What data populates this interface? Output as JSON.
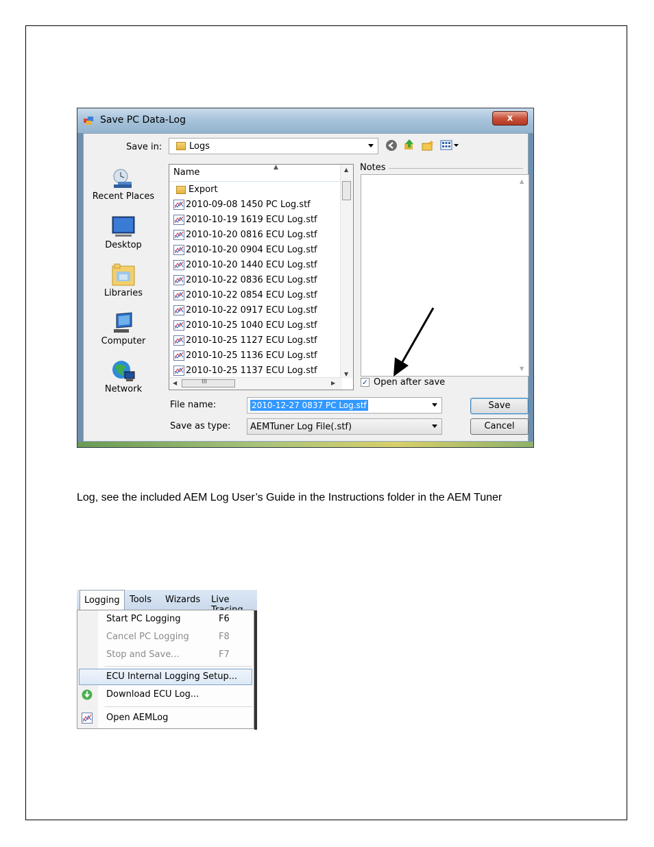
{
  "save_dialog": {
    "title": "Save PC Data-Log",
    "close_label": "x",
    "save_in_label": "Save in:",
    "save_in_value": "Logs",
    "places": [
      "Recent Places",
      "Desktop",
      "Libraries",
      "Computer",
      "Network"
    ],
    "list_header": "Name",
    "files": [
      "Export",
      "2010-09-08 1450 PC Log.stf",
      "2010-10-19 1619 ECU Log.stf",
      "2010-10-20 0816 ECU Log.stf",
      "2010-10-20 0904 ECU Log.stf",
      "2010-10-20 1440 ECU Log.stf",
      "2010-10-22 0836 ECU Log.stf",
      "2010-10-22 0854 ECU Log.stf",
      "2010-10-22 0917 ECU Log.stf",
      "2010-10-25 1040 ECU Log.stf",
      "2010-10-25 1127 ECU Log.stf",
      "2010-10-25 1136 ECU Log.stf",
      "2010-10-25 1137 ECU Log.stf"
    ],
    "hscroll_thumb_label": "III",
    "notes_label": "Notes",
    "open_after_save_label": "Open after save",
    "open_after_save_checked": "✓",
    "file_name_label": "File name:",
    "file_name_value": "2010-12-27 0837 PC Log.stf",
    "save_as_type_label": "Save as type:",
    "save_as_type_value": "AEMTuner Log File(.stf)",
    "save_button": "Save",
    "cancel_button": "Cancel"
  },
  "body_text": "Log, see the included AEM Log User’s Guide in the Instructions folder in the AEM Tuner",
  "logging_menu": {
    "menubar": [
      "Logging",
      "Tools",
      "Wizards",
      "Live Tracing"
    ],
    "items": [
      {
        "label": "Start PC Logging",
        "shortcut": "F6"
      },
      {
        "label": "Cancel PC Logging",
        "shortcut": "F8"
      },
      {
        "label": "Stop and Save...",
        "shortcut": "F7"
      },
      {
        "label": "ECU Internal Logging Setup...",
        "shortcut": ""
      },
      {
        "label": "Download ECU Log...",
        "shortcut": ""
      },
      {
        "label": "Open AEMLog",
        "shortcut": ""
      }
    ]
  }
}
